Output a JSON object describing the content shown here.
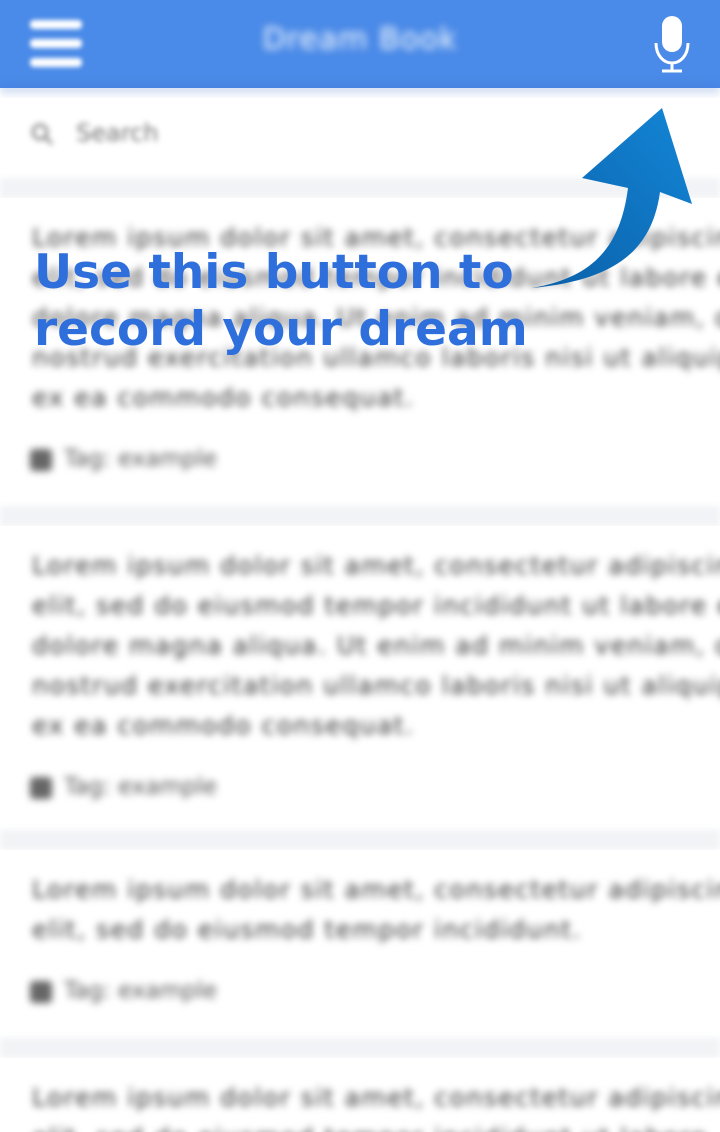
{
  "appbar": {
    "title": "Dream Book",
    "background_color": "#4a8ae8",
    "menu_icon": "hamburger-menu-icon",
    "mic_icon": "microphone-icon"
  },
  "search": {
    "icon": "search-icon",
    "placeholder": "Search"
  },
  "entries": [
    {
      "lines": [
        "Lorem ipsum dolor sit amet, consectetur adipiscing",
        "elit, sed do eiusmod tempor incididunt ut labore et",
        "dolore magna aliqua. Ut enim ad minim veniam, quis",
        "nostrud exercitation ullamco laboris nisi ut aliquip",
        "ex ea commodo consequat."
      ],
      "tag": "Tag: example"
    },
    {
      "lines": [
        "Lorem ipsum dolor sit amet, consectetur adipiscing",
        "elit, sed do eiusmod tempor incididunt ut labore et",
        "dolore magna aliqua. Ut enim ad minim veniam, quis",
        "nostrud exercitation ullamco laboris nisi ut aliquip",
        "ex ea commodo consequat."
      ],
      "tag": "Tag: example"
    },
    {
      "lines": [
        "Lorem ipsum dolor sit amet, consectetur adipiscing",
        "elit, sed do eiusmod tempor incididunt."
      ],
      "tag": "Tag: example"
    },
    {
      "lines": [
        "Lorem ipsum dolor sit amet, consectetur adipiscing",
        "elit, sed do eiusmod tempor incididunt ut labore."
      ],
      "tag": ""
    }
  ],
  "tutorial": {
    "text": "Use this button to\nrecord your dream",
    "text_color": "#2f6fdc",
    "arrow_color": "#0b76c4",
    "arrow_icon": "curved-arrow-icon"
  }
}
